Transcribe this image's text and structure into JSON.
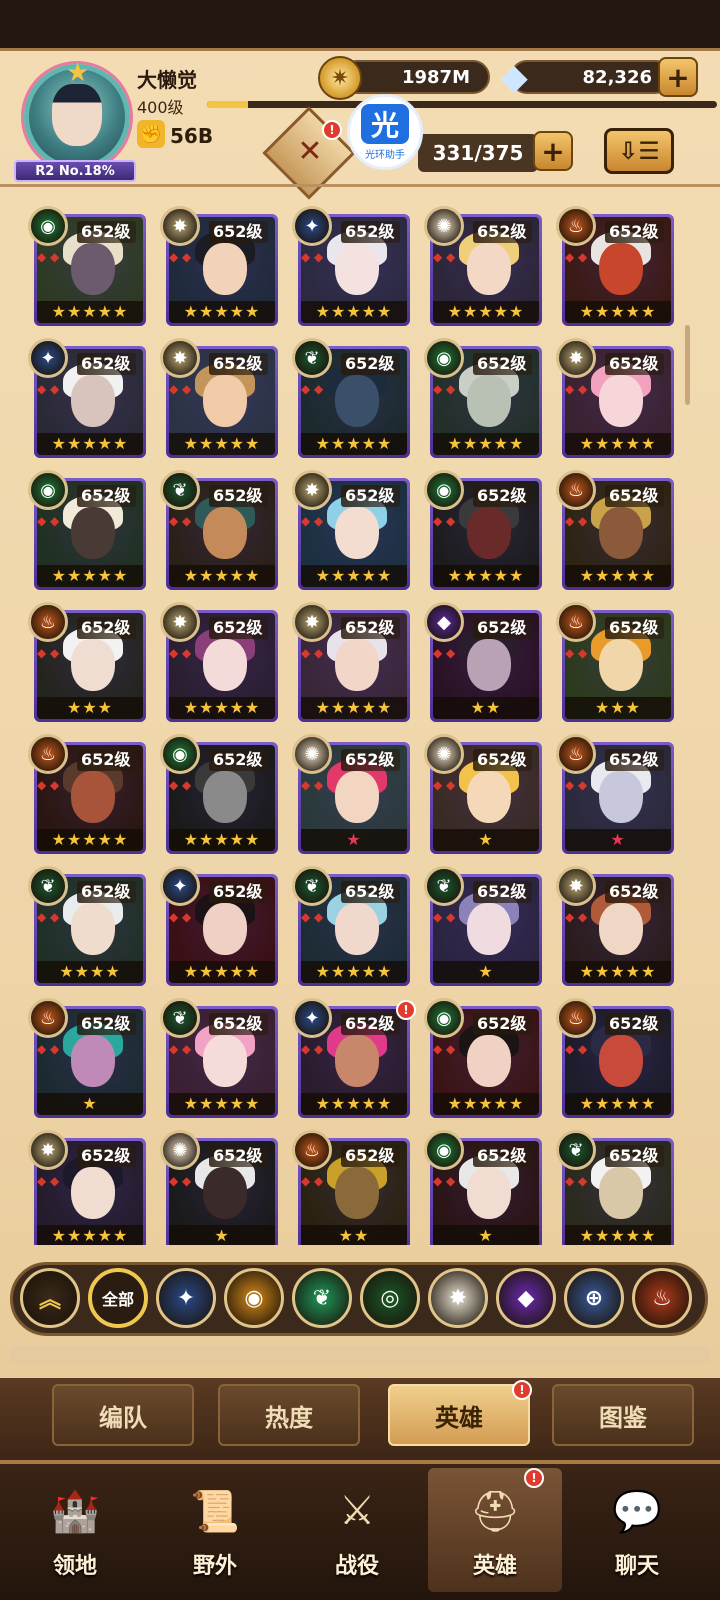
{
  "player": {
    "name": "大懒觉",
    "level": "400级",
    "xp_fraction": 0.08,
    "power": "56B",
    "rank": "R2 No.18%"
  },
  "resources": {
    "gold": "1987M",
    "gems": "82,326"
  },
  "overlay": {
    "label": "光环助手",
    "glyph": "光"
  },
  "heroes_count": "331/375",
  "heroes": [
    {
      "level": "652级",
      "faction": "wilder",
      "stars": 5,
      "star_color": "gold",
      "hair": "#e8e0c8",
      "skin": "#6c5a6e",
      "bg": "#2d3a22"
    },
    {
      "level": "652级",
      "faction": "celestial",
      "stars": 5,
      "star_color": "gold",
      "hair": "#1c1c24",
      "skin": "#f2d2b8",
      "bg": "#1f2a3a"
    },
    {
      "level": "652级",
      "faction": "lightbearer",
      "stars": 5,
      "star_color": "gold",
      "hair": "#e9e6ee",
      "skin": "#f4e2e0",
      "bg": "#2b2a40"
    },
    {
      "level": "652级",
      "faction": "hypogean",
      "stars": 5,
      "star_color": "gold",
      "hair": "#f0cf7a",
      "skin": "#f4d8c6",
      "bg": "#2c2638"
    },
    {
      "level": "652级",
      "faction": "mauler",
      "stars": 5,
      "star_color": "gold",
      "hair": "#e9e4e2",
      "skin": "#c8462c",
      "bg": "#3a1a14"
    },
    {
      "level": "652级",
      "faction": "lightbearer",
      "stars": 5,
      "star_color": "gold",
      "hair": "#f1f1f1",
      "skin": "#d8c4bc",
      "bg": "#2a2a36"
    },
    {
      "level": "652级",
      "faction": "celestial",
      "stars": 5,
      "star_color": "gold",
      "hair": "#c4955a",
      "skin": "#f1cba8",
      "bg": "#2a3344"
    },
    {
      "level": "652级",
      "faction": "graveborn",
      "stars": 5,
      "star_color": "gold",
      "hair": "#1c2c3c",
      "skin": "#3a4f6a",
      "bg": "#1b2a2c"
    },
    {
      "level": "652级",
      "faction": "wilder",
      "stars": 5,
      "star_color": "gold",
      "hair": "#c9cfc6",
      "skin": "#b9c1b5",
      "bg": "#223028"
    },
    {
      "level": "652级",
      "faction": "celestial",
      "stars": 5,
      "star_color": "gold",
      "hair": "#f2a2be",
      "skin": "#f6d6d8",
      "bg": "#3a2230"
    },
    {
      "level": "652级",
      "faction": "wilder",
      "stars": 5,
      "star_color": "gold",
      "hair": "#f2ead8",
      "skin": "#4a3a36",
      "bg": "#203022"
    },
    {
      "level": "652级",
      "faction": "graveborn",
      "stars": 5,
      "star_color": "gold",
      "hair": "#2f5a5a",
      "skin": "#c48a5a",
      "bg": "#2a2018"
    },
    {
      "level": "652级",
      "faction": "celestial",
      "stars": 5,
      "star_color": "gold",
      "hair": "#8ed0e6",
      "skin": "#f2ddd0",
      "bg": "#1c3040"
    },
    {
      "level": "652级",
      "faction": "wilder",
      "stars": 5,
      "star_color": "gold",
      "hair": "#3a3a3a",
      "skin": "#6a2a2a",
      "bg": "#1c1c1c"
    },
    {
      "level": "652级",
      "faction": "mauler",
      "stars": 5,
      "star_color": "gold",
      "hair": "#c9a24a",
      "skin": "#8a5a3a",
      "bg": "#2e2414"
    },
    {
      "level": "652级",
      "faction": "mauler",
      "stars": 3,
      "star_color": "gold",
      "hair": "#f2f2f2",
      "skin": "#f0ddd2",
      "bg": "#24241e"
    },
    {
      "level": "652级",
      "faction": "celestial",
      "stars": 5,
      "star_color": "gold",
      "hair": "#8a3e7a",
      "skin": "#f4dad8",
      "bg": "#2a1e30"
    },
    {
      "level": "652级",
      "faction": "celestial",
      "stars": 5,
      "star_color": "gold",
      "hair": "#e8e2ea",
      "skin": "#f2d6c8",
      "bg": "#3a2638"
    },
    {
      "level": "652级",
      "faction": "dimensional",
      "stars": 2,
      "star_color": "gold",
      "hair": "#2a1e2e",
      "skin": "#b9a2b4",
      "bg": "#2a1224"
    },
    {
      "level": "652级",
      "faction": "mauler",
      "stars": 3,
      "star_color": "gold",
      "hair": "#e89a2a",
      "skin": "#f0d6a8",
      "bg": "#2c3a1c"
    },
    {
      "level": "652级",
      "faction": "mauler",
      "stars": 5,
      "star_color": "gold",
      "hair": "#5a3a2a",
      "skin": "#a8543a",
      "bg": "#2a1610"
    },
    {
      "level": "652级",
      "faction": "wilder",
      "stars": 5,
      "star_color": "gold",
      "hair": "#3a3a3a",
      "skin": "#8a8a8a",
      "bg": "#1a1a1a"
    },
    {
      "level": "652级",
      "faction": "hypogean",
      "stars": 1,
      "star_color": "red",
      "hair": "#e2386a",
      "skin": "#f2d6c2",
      "bg": "#2a3a3a"
    },
    {
      "level": "652级",
      "faction": "hypogean",
      "stars": 1,
      "star_color": "gold",
      "hair": "#f2c24a",
      "skin": "#f4d8b8",
      "bg": "#3a2a24"
    },
    {
      "level": "652级",
      "faction": "mauler",
      "stars": 1,
      "star_color": "red",
      "hair": "#e8eaf0",
      "skin": "#c8c8dc",
      "bg": "#2a2a3a"
    },
    {
      "level": "652级",
      "faction": "graveborn",
      "stars": 4,
      "star_color": "gold",
      "hair": "#e8ecec",
      "skin": "#f0dccc",
      "bg": "#203026"
    },
    {
      "level": "652级",
      "faction": "lightbearer",
      "stars": 5,
      "star_color": "gold",
      "hair": "#1a1216",
      "skin": "#f0d0c4",
      "bg": "#3a1014"
    },
    {
      "level": "652级",
      "faction": "graveborn",
      "stars": 5,
      "star_color": "gold",
      "hair": "#9ad2e2",
      "skin": "#f0d8cc",
      "bg": "#1c2c34"
    },
    {
      "level": "652级",
      "faction": "graveborn",
      "stars": 1,
      "star_color": "gold",
      "hair": "#8a82b8",
      "skin": "#f0dce0",
      "bg": "#2a2440"
    },
    {
      "level": "652级",
      "faction": "celestial",
      "stars": 5,
      "star_color": "gold",
      "hair": "#b05a3a",
      "skin": "#f0d6c4",
      "bg": "#2a1c1c"
    },
    {
      "level": "652级",
      "faction": "mauler",
      "stars": 1,
      "star_color": "gold",
      "hair": "#2aa8a0",
      "skin": "#c08ab8",
      "bg": "#1c2a30"
    },
    {
      "level": "652级",
      "faction": "graveborn",
      "stars": 5,
      "star_color": "gold",
      "hair": "#f2a2c4",
      "skin": "#f6dcd8",
      "bg": "#3a2030"
    },
    {
      "level": "652级",
      "faction": "lightbearer",
      "stars": 5,
      "star_color": "gold",
      "hair": "#e23a8a",
      "skin": "#c8866a",
      "bg": "#2a1c2c",
      "alert": true
    },
    {
      "level": "652级",
      "faction": "wilder",
      "stars": 5,
      "star_color": "gold",
      "hair": "#1a1414",
      "skin": "#f0d2c4",
      "bg": "#3a1414"
    },
    {
      "level": "652级",
      "faction": "mauler",
      "stars": 5,
      "star_color": "gold",
      "hair": "#2a2a44",
      "skin": "#c84a3a",
      "bg": "#1c1c2a"
    },
    {
      "level": "652级",
      "faction": "celestial",
      "stars": 5,
      "star_color": "gold",
      "hair": "#1c1a2a",
      "skin": "#f0dcd0",
      "bg": "#241c2c"
    },
    {
      "level": "652级",
      "faction": "hypogean",
      "stars": 1,
      "star_color": "gold",
      "hair": "#e8e8e8",
      "skin": "#3a2a2a",
      "bg": "#1a1a1a"
    },
    {
      "level": "652级",
      "faction": "mauler",
      "stars": 2,
      "star_color": "gold",
      "hair": "#c8a02a",
      "skin": "#8a6a3a",
      "bg": "#2a2210"
    },
    {
      "level": "652级",
      "faction": "wilder",
      "stars": 1,
      "star_color": "gold",
      "hair": "#e8e8e8",
      "skin": "#f0dcd0",
      "bg": "#2a1414"
    },
    {
      "level": "652级",
      "faction": "graveborn",
      "stars": 5,
      "star_color": "gold",
      "hair": "#f2f2f2",
      "skin": "#d8c8a8",
      "bg": "#2a2a1c"
    }
  ],
  "filters": [
    {
      "key": "collapse",
      "label": "",
      "icon": "double-chevron-up-icon",
      "color": "#3a2a1a",
      "glyph": "︽"
    },
    {
      "key": "all",
      "label": "全部",
      "icon": "all-factions-icon",
      "color": "#2a1c10",
      "glyph": ""
    },
    {
      "key": "lightbearer",
      "label": "",
      "icon": "lightbearer-icon",
      "color": "#2a4a8a",
      "glyph": "✦"
    },
    {
      "key": "mauler",
      "label": "",
      "icon": "mauler-icon",
      "color": "#d58a1a",
      "glyph": "◉"
    },
    {
      "key": "wilder",
      "label": "",
      "icon": "wilder-icon",
      "color": "#1e9a5a",
      "glyph": "❦"
    },
    {
      "key": "graveborn",
      "label": "",
      "icon": "graveborn-icon",
      "color": "#1a5a2a",
      "glyph": "◎"
    },
    {
      "key": "celestial",
      "label": "",
      "icon": "celestial-icon",
      "color": "#e8e2d2",
      "glyph": "✸"
    },
    {
      "key": "hypogean",
      "label": "",
      "icon": "hypogean-icon",
      "color": "#6a2ab0",
      "glyph": "◆"
    },
    {
      "key": "dimensional",
      "label": "",
      "icon": "dimensional-icon",
      "color": "#3a5a9a",
      "glyph": "⊕"
    },
    {
      "key": "draconis",
      "label": "",
      "icon": "draconis-icon",
      "color": "#b03a1a",
      "glyph": "♨"
    }
  ],
  "subtabs": [
    {
      "label": "编队",
      "active": false
    },
    {
      "label": "热度",
      "active": false
    },
    {
      "label": "英雄",
      "active": true
    },
    {
      "label": "图鉴",
      "active": false
    }
  ],
  "nav": [
    {
      "label": "领地",
      "icon": "castle-icon",
      "glyph": "🏰",
      "active": false
    },
    {
      "label": "野外",
      "icon": "map-scroll-icon",
      "glyph": "📜",
      "active": false
    },
    {
      "label": "战役",
      "icon": "sword-battle-icon",
      "glyph": "⚔",
      "active": false
    },
    {
      "label": "英雄",
      "icon": "hero-helmet-icon",
      "glyph": "⛑",
      "active": true,
      "alert": true
    },
    {
      "label": "聊天",
      "icon": "chat-bubble-icon",
      "glyph": "💬",
      "active": false
    }
  ],
  "alert_mark": "!",
  "colors": {
    "faction_lightbearer": "#2a4a8a",
    "faction_mauler": "#c4581c",
    "faction_wilder": "#1e7a3a",
    "faction_graveborn": "#1a4a2a",
    "faction_celestial": "#c8b88a",
    "faction_hypogean": "#5a2aa0",
    "faction_dimensional": "#3a5a9a"
  }
}
